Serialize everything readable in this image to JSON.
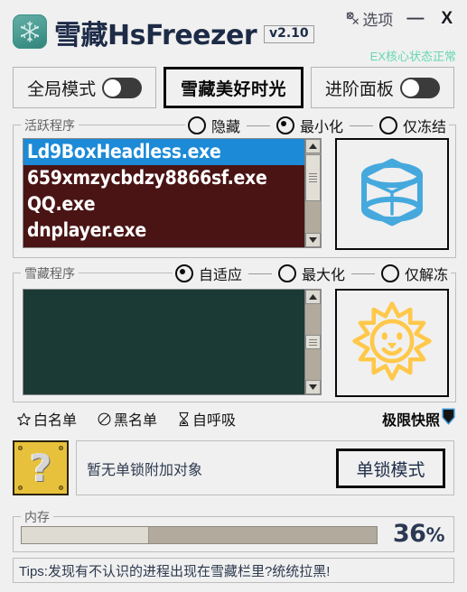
{
  "window": {
    "app_title_cn": "雪藏",
    "app_title_en": "HsFreezer",
    "version": "v2.10",
    "options_label": "选项",
    "minimize_label": "—",
    "close_label": "X",
    "status_text": "EX核心状态正常",
    "logo_icon": "snowflake-icon",
    "options_icon": "wrench-icon"
  },
  "toolbar": {
    "global_mode_label": "全局模式",
    "global_mode_on": false,
    "main_button_label": "雪藏美好时光",
    "advanced_panel_label": "进阶面板",
    "advanced_panel_on": false
  },
  "active_group": {
    "legend": "活跃程序",
    "radios": [
      {
        "label": "隐藏",
        "selected": false
      },
      {
        "label": "最小化",
        "selected": true
      },
      {
        "label": "仅冻结",
        "selected": false
      }
    ],
    "processes": [
      {
        "name": "Ld9BoxHeadless.exe",
        "selected": true
      },
      {
        "name": "659xmzycbdzy8866sf.exe",
        "selected": false
      },
      {
        "name": "QQ.exe",
        "selected": false
      },
      {
        "name": "dnplayer.exe",
        "selected": false
      }
    ],
    "panel_icon": "cube-icon",
    "panel_icon_color": "#45a9dd"
  },
  "frozen_group": {
    "legend": "雪藏程序",
    "radios": [
      {
        "label": "自适应",
        "selected": true
      },
      {
        "label": "最大化",
        "selected": false
      },
      {
        "label": "仅解冻",
        "selected": false
      }
    ],
    "processes": [],
    "panel_icon": "sun-smile-icon",
    "panel_icon_color": "#ffc84a"
  },
  "tools": [
    {
      "label": "白名单",
      "icon": "star-icon"
    },
    {
      "label": "黑名单",
      "icon": "ban-circle-icon"
    },
    {
      "label": "自呼吸",
      "icon": "hourglass-icon"
    }
  ],
  "snapshot": {
    "label": "极限快照",
    "icon": "shield-icon"
  },
  "lock_row": {
    "block_icon": "question-block-icon",
    "block_glyph": "?",
    "status_text": "暂无单锁附加对象",
    "button_label": "单锁模式"
  },
  "memory": {
    "legend": "内存",
    "percent": 36,
    "percent_text": "36",
    "percent_symbol": "%"
  },
  "tips": {
    "text": "Tips:发现有不认识的进程出现在雪藏栏里?统统拉黑!"
  },
  "colors": {
    "background": "#f0f0f0",
    "active_list_bg": "#4a1414",
    "frozen_list_bg": "#1b3935",
    "selection_blue": "#1c8ad6",
    "status_green": "#64d9ae",
    "title_navy": "#1d2b47"
  }
}
